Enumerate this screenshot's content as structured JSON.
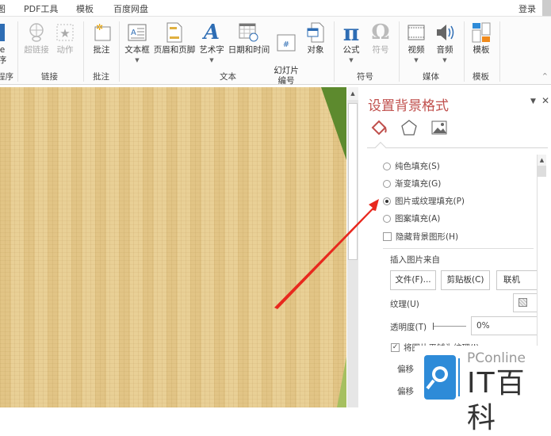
{
  "menu": {
    "items": [
      "PDF工具",
      "模板",
      "百度网盘"
    ],
    "login": "登录",
    "partial": "图"
  },
  "ribbon": {
    "partial_btn": {
      "l1": "e",
      "l2": "序"
    },
    "partial_group": "程序",
    "buttons": [
      {
        "id": "hyperlink",
        "label": "超链接",
        "disabled": true
      },
      {
        "id": "action",
        "label": "动作",
        "disabled": true
      },
      {
        "id": "comment",
        "label": "批注"
      },
      {
        "id": "textbox",
        "label": "文本框"
      },
      {
        "id": "header-footer",
        "label": "页眉和页脚"
      },
      {
        "id": "wordart",
        "label": "艺术字"
      },
      {
        "id": "datetime",
        "label": "日期和时间"
      },
      {
        "id": "slide-number",
        "label": "幻灯片\n编号"
      },
      {
        "id": "object",
        "label": "对象"
      },
      {
        "id": "equation",
        "label": "公式"
      },
      {
        "id": "symbol",
        "label": "符号",
        "disabled": true
      },
      {
        "id": "video",
        "label": "视频"
      },
      {
        "id": "audio",
        "label": "音频"
      },
      {
        "id": "template",
        "label": "模板"
      }
    ],
    "groups": [
      "链接",
      "批注",
      "文本",
      "符号",
      "媒体",
      "模板"
    ]
  },
  "panel": {
    "title": "设置背景格式",
    "fill_options": [
      {
        "label": "纯色填充(S)",
        "selected": false
      },
      {
        "label": "渐变填充(G)",
        "selected": false
      },
      {
        "label": "图片或纹理填充(P)",
        "selected": true
      },
      {
        "label": "图案填充(A)",
        "selected": false
      }
    ],
    "hide_bg": {
      "label": "隐藏背景图形(H)",
      "checked": false
    },
    "insert_from": "插入图片来自",
    "buttons": [
      "文件(F)...",
      "剪贴板(C)",
      "联机(E)..."
    ],
    "texture_label": "纹理(U)",
    "transparency_label": "透明度(T)",
    "transparency_value": "0%",
    "tile": {
      "label": "将图片平铺为纹理(I)",
      "checked": true
    },
    "offset_labels": [
      "偏移",
      "偏移"
    ]
  },
  "watermark": {
    "brand": "PConline",
    "name": "IT百科"
  },
  "colors": {
    "accent": "#c0504d",
    "arrow": "#e8281e",
    "slide_green": "#5d8a2e"
  }
}
